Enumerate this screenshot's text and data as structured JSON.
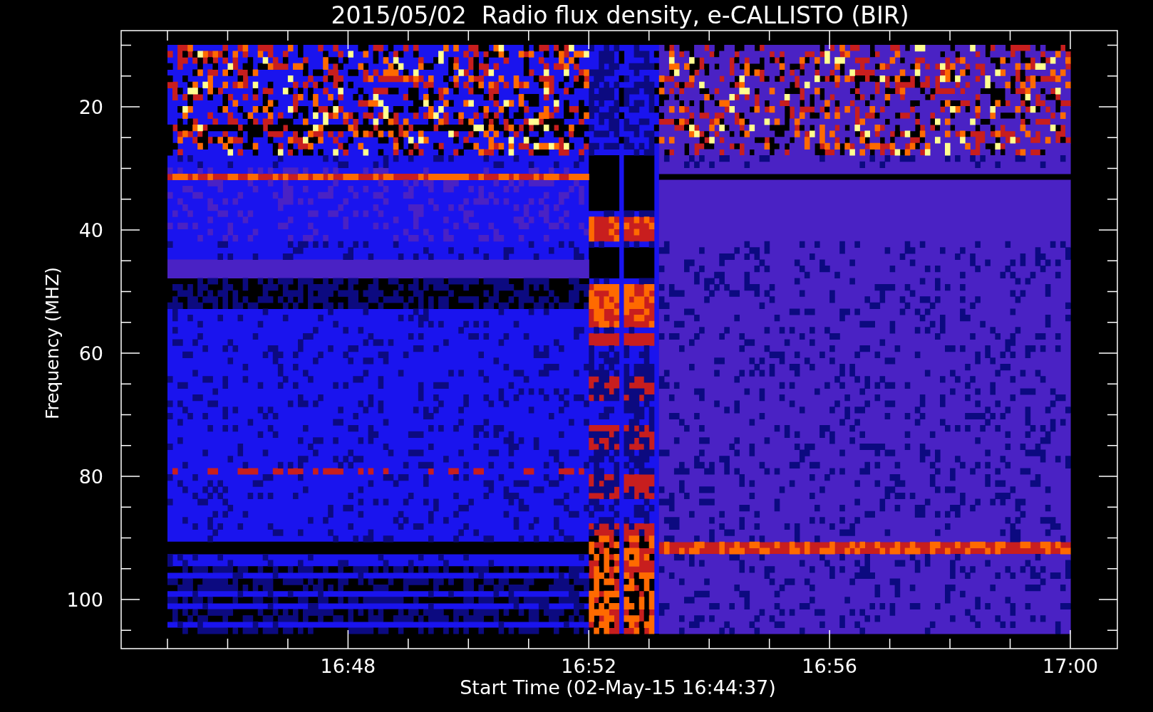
{
  "plot": {
    "title": "2015/05/02  Radio flux density, e-CALLISTO (BIR)",
    "y_axis": {
      "label": "Frequency (MHZ)",
      "tick_labels": [
        "20",
        "40",
        "60",
        "80",
        "100"
      ]
    },
    "x_axis": {
      "label": "Start Time (02-May-15 16:44:37)",
      "tick_labels": [
        "16:48",
        "16:52",
        "16:56",
        "17:00"
      ]
    }
  }
}
